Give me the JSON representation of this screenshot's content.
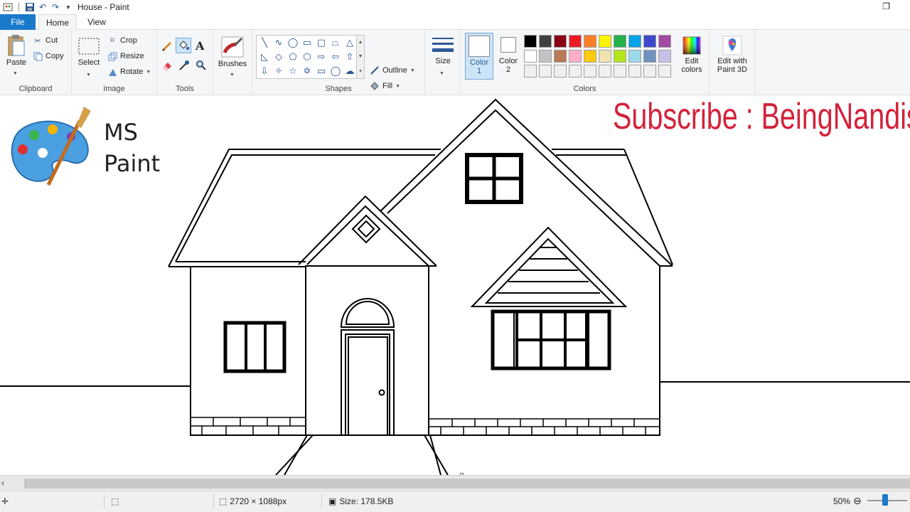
{
  "window": {
    "title": "House - Paint"
  },
  "tabs": {
    "file": "File",
    "home": "Home",
    "view": "View"
  },
  "ribbon": {
    "clipboard": {
      "label": "Clipboard",
      "paste": "Paste",
      "cut": "Cut",
      "copy": "Copy"
    },
    "image": {
      "label": "Image",
      "select": "Select",
      "crop": "Crop",
      "resize": "Resize",
      "rotate": "Rotate"
    },
    "tools": {
      "label": "Tools"
    },
    "brushes": {
      "label": "Brushes"
    },
    "shapes": {
      "label": "Shapes",
      "outline": "Outline",
      "fill": "Fill"
    },
    "size": {
      "label": "Size"
    },
    "colors": {
      "label": "Colors",
      "color1": "Color\n1",
      "color2": "Color\n2",
      "edit_colors": "Edit\ncolors",
      "edit_paint3d": "Edit with\nPaint 3D",
      "color1_value": "#ffffff",
      "color2_value": "#ffffff",
      "palette": [
        "#000000",
        "#404040",
        "#880015",
        "#ed1c24",
        "#ff7f27",
        "#fff200",
        "#22b14c",
        "#00a2e8",
        "#3f48cc",
        "#a349a4",
        "#ffffff",
        "#c3c3c3",
        "#b97a57",
        "#ffaec9",
        "#ffc90e",
        "#efe4b0",
        "#b5e61d",
        "#99d9ea",
        "#7092be",
        "#c8bfe7",
        "#f0f0f0",
        "#f0f0f0",
        "#f0f0f0",
        "#f0f0f0",
        "#f0f0f0",
        "#f0f0f0",
        "#f0f0f0",
        "#f0f0f0",
        "#f0f0f0",
        "#f0f0f0"
      ]
    }
  },
  "canvas": {
    "logo_line1": "MS",
    "logo_line2": "Paint",
    "subscribe": "Subscribe : BeingNandish"
  },
  "statusbar": {
    "dimensions": "2720 × 1088px",
    "size": "Size: 178.5KB",
    "zoom": "50%"
  }
}
